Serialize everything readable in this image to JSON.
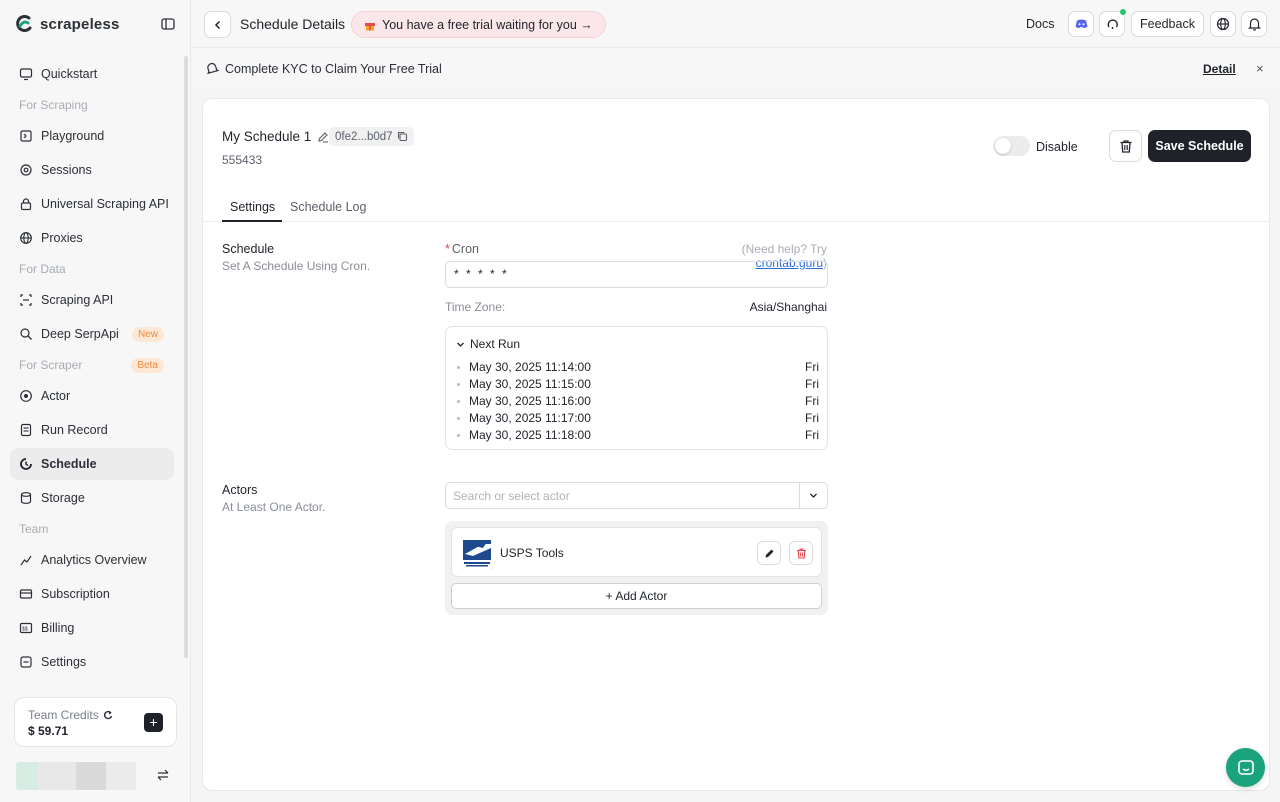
{
  "brand": {
    "name": "scrapeless",
    "accent": "#1aa37c"
  },
  "sidebar": {
    "items": [
      {
        "type": "item",
        "label": "Quickstart",
        "icon": "monitor-icon"
      },
      {
        "type": "section",
        "label": "For Scraping"
      },
      {
        "type": "item",
        "label": "Playground",
        "icon": "playground-icon"
      },
      {
        "type": "item",
        "label": "Sessions",
        "icon": "sessions-icon"
      },
      {
        "type": "item",
        "label": "Universal Scraping API",
        "icon": "lock-icon"
      },
      {
        "type": "item",
        "label": "Proxies",
        "icon": "globe-icon"
      },
      {
        "type": "section",
        "label": "For Data"
      },
      {
        "type": "item",
        "label": "Scraping API",
        "icon": "scraping-api-icon"
      },
      {
        "type": "item",
        "label": "Deep SerpApi",
        "icon": "serp-icon",
        "badge": "New"
      },
      {
        "type": "section",
        "label": "For Scraper",
        "badge": "Beta"
      },
      {
        "type": "item",
        "label": "Actor",
        "icon": "actor-icon"
      },
      {
        "type": "item",
        "label": "Run Record",
        "icon": "run-record-icon"
      },
      {
        "type": "item",
        "label": "Schedule",
        "icon": "schedule-icon",
        "active": true
      },
      {
        "type": "item",
        "label": "Storage",
        "icon": "storage-icon"
      },
      {
        "type": "section",
        "label": "Team"
      },
      {
        "type": "item",
        "label": "Analytics Overview",
        "icon": "analytics-icon"
      },
      {
        "type": "item",
        "label": "Subscription",
        "icon": "subscription-icon"
      },
      {
        "type": "item",
        "label": "Billing",
        "icon": "billing-icon"
      },
      {
        "type": "item",
        "label": "Settings",
        "icon": "settings-icon"
      }
    ],
    "credits": {
      "label": "Team Credits",
      "value": "$ 59.71"
    }
  },
  "topbar": {
    "title": "Schedule Details",
    "trial": "You have a free trial waiting for you →",
    "docs": "Docs",
    "feedback": "Feedback"
  },
  "kyc": {
    "text": "Complete KYC to Claim Your Free Trial",
    "detail": "Detail",
    "close": "×"
  },
  "schedule": {
    "name": "My Schedule 1",
    "id": "0fe2...b0d7",
    "number": "555433",
    "toggle_label": "Disable",
    "enabled": false,
    "save": "Save Schedule"
  },
  "tabs": [
    "Settings",
    "Schedule Log"
  ],
  "settings": {
    "schedule_title": "Schedule",
    "schedule_sub": "Set A Schedule Using Cron.",
    "cron_label": "Cron",
    "help_prefix": "(Need help? Try ",
    "help_link": "crontab.guru",
    "help_suffix": ")",
    "cron_value": "* * * * *",
    "tz_label": "Time Zone:",
    "tz_value": "Asia/Shanghai",
    "next_run_title": "Next Run",
    "next_runs": [
      {
        "date": "May 30, 2025 11:14:00",
        "day": "Fri"
      },
      {
        "date": "May 30, 2025 11:15:00",
        "day": "Fri"
      },
      {
        "date": "May 30, 2025 11:16:00",
        "day": "Fri"
      },
      {
        "date": "May 30, 2025 11:17:00",
        "day": "Fri"
      },
      {
        "date": "May 30, 2025 11:18:00",
        "day": "Fri"
      }
    ],
    "actors_title": "Actors",
    "actors_sub": "At Least One Actor.",
    "actor_placeholder": "Search or select actor",
    "actor_name": "USPS Tools",
    "add_actor": "+ Add Actor"
  }
}
